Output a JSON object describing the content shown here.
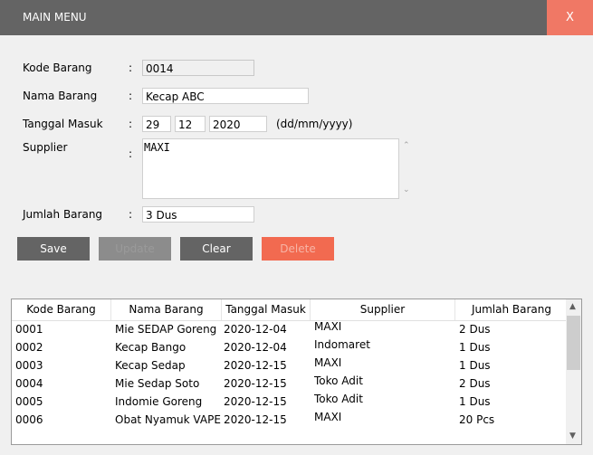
{
  "window": {
    "title": "MAIN MENU",
    "close_label": "X"
  },
  "form": {
    "kode_label": "Kode Barang",
    "nama_label": "Nama Barang",
    "tanggal_label": "Tanggal Masuk",
    "supplier_label": "Supplier",
    "jumlah_label": "Jumlah Barang",
    "colon": ":",
    "kode_value": "0014",
    "nama_value": "Kecap ABC",
    "day_value": "29",
    "month_value": "12",
    "year_value": "2020",
    "date_hint": "(dd/mm/yyyy)",
    "supplier_value": "MAXI",
    "jumlah_value": "3 Dus"
  },
  "buttons": {
    "save": "Save",
    "update": "Update",
    "clear": "Clear",
    "delete": "Delete"
  },
  "colors": {
    "titlebar": "#646464",
    "close": "#f07865",
    "button": "#646464",
    "button_disabled": "#8c8c8c",
    "delete": "#f26a50"
  },
  "table": {
    "columns": [
      "Kode Barang",
      "Nama Barang",
      "Tanggal Masuk",
      "Supplier",
      "Jumlah Barang"
    ],
    "rows": [
      [
        "0001",
        "Mie SEDAP Goreng",
        "2020-12-04",
        "MAXI",
        "2 Dus"
      ],
      [
        "0002",
        "Kecap Bango",
        "2020-12-04",
        "Indomaret",
        "1 Dus"
      ],
      [
        "0003",
        "Kecap Sedap",
        "2020-12-15",
        "MAXI",
        "1 Dus"
      ],
      [
        "0004",
        "Mie Sedap Soto",
        "2020-12-15",
        "Toko Adit",
        "2 Dus"
      ],
      [
        "0005",
        "Indomie Goreng",
        "2020-12-15",
        "Toko Adit",
        "1 Dus"
      ],
      [
        "0006",
        "Obat Nyamuk VAPE",
        "2020-12-15",
        "MAXI",
        "20 Pcs"
      ]
    ]
  }
}
